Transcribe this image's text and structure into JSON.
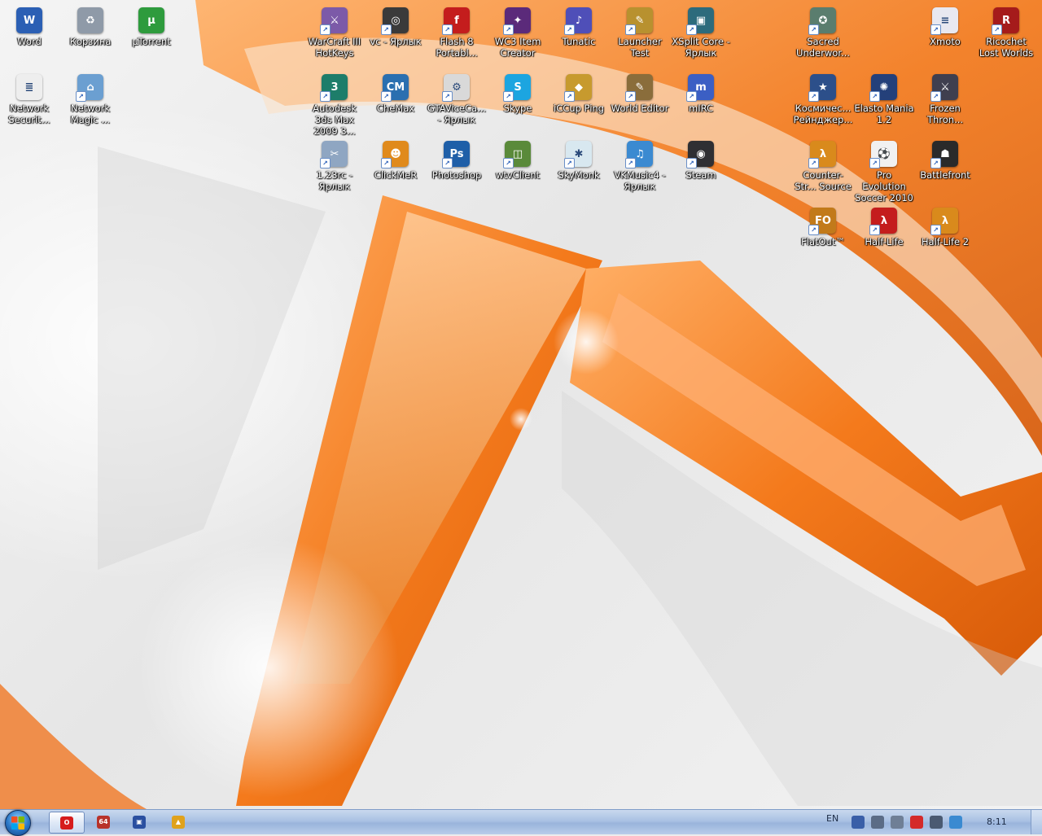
{
  "desktop_icons": [
    {
      "label": "Word",
      "icon": "word-icon",
      "color": "#2b5fb4",
      "glyph": "W",
      "shortcut": false
    },
    {
      "label": "Корзина",
      "icon": "recycle-bin-icon",
      "color": "#8f9aa8",
      "glyph": "♻",
      "shortcut": false
    },
    {
      "label": "µTorrent",
      "icon": "utorrent-icon",
      "color": "#2e9b3d",
      "glyph": "µ",
      "shortcut": false
    },
    {
      "label": "WarCraft III HotKeys",
      "icon": "warcraft-hotkeys-icon",
      "color": "#7c5aa8",
      "glyph": "⚔",
      "shortcut": true
    },
    {
      "label": "vc - Ярлык",
      "icon": "film-reel-icon",
      "color": "#3a3a3a",
      "glyph": "◎",
      "shortcut": true
    },
    {
      "label": "Flash 8 Portabl...",
      "icon": "flash-icon",
      "color": "#c41d1d",
      "glyph": "f",
      "shortcut": true
    },
    {
      "label": "WC3 Item Creator",
      "icon": "wc3-item-creator-icon",
      "color": "#5b2a7a",
      "glyph": "✦",
      "shortcut": true
    },
    {
      "label": "Tunatic",
      "icon": "tunatic-icon",
      "color": "#4f4fb8",
      "glyph": "♪",
      "shortcut": true
    },
    {
      "label": "Launcher Test",
      "icon": "launcher-icon",
      "color": "#b8912f",
      "glyph": "✎",
      "shortcut": true
    },
    {
      "label": "XSplit Core - Ярлык",
      "icon": "xsplit-icon",
      "color": "#2d6b7c",
      "glyph": "▣",
      "shortcut": true
    },
    {
      "label": "Sacred Underwor...",
      "icon": "sacred-icon",
      "color": "#5a7d6e",
      "glyph": "✪",
      "shortcut": true
    },
    {
      "label": "Xmoto",
      "icon": "xmoto-icon",
      "color": "#e8e8f0",
      "glyph": "≡",
      "shortcut": true
    },
    {
      "label": "Ricochet Lost Worlds",
      "icon": "ricochet-icon",
      "color": "#a51b1b",
      "glyph": "R",
      "shortcut": true
    },
    {
      "label": "Network Securit...",
      "icon": "document-icon",
      "color": "#eeeeee",
      "glyph": "≣",
      "shortcut": false
    },
    {
      "label": "Network Magic ...",
      "icon": "network-magic-icon",
      "color": "#6b9fd1",
      "glyph": "⌂",
      "shortcut": true
    },
    {
      "label": "Autodesk 3ds Max 2009 3...",
      "icon": "3ds-max-icon",
      "color": "#1d7d6a",
      "glyph": "3",
      "shortcut": true
    },
    {
      "label": "CheMax",
      "icon": "chemax-icon",
      "color": "#2a6fb0",
      "glyph": "CM",
      "shortcut": true
    },
    {
      "label": "GTAViceCa... - Ярлык",
      "icon": "gta-icon",
      "color": "#d9d9d9",
      "glyph": "⚙",
      "shortcut": true
    },
    {
      "label": "Skype",
      "icon": "skype-icon",
      "color": "#1ca5e0",
      "glyph": "S",
      "shortcut": true
    },
    {
      "label": "iCCup Ping",
      "icon": "iccup-icon",
      "color": "#c79a2e",
      "glyph": "◆",
      "shortcut": true
    },
    {
      "label": "World Editor",
      "icon": "world-editor-icon",
      "color": "#8a6d3b",
      "glyph": "✎",
      "shortcut": true
    },
    {
      "label": "mIRC",
      "icon": "mirc-icon",
      "color": "#3b5fc4",
      "glyph": "m",
      "shortcut": true
    },
    {
      "label": "Космичес... Рейнджер...",
      "icon": "space-rangers-icon",
      "color": "#2c4f8a",
      "glyph": "★",
      "shortcut": true
    },
    {
      "label": "Elasto Mania 1.2",
      "icon": "elasto-mania-icon",
      "color": "#24407a",
      "glyph": "✺",
      "shortcut": true
    },
    {
      "label": "Frozen Thron...",
      "icon": "frozen-throne-icon",
      "color": "#3f3f4f",
      "glyph": "⚔",
      "shortcut": true
    },
    {
      "label": "1.23rc - Ярлык",
      "icon": "wrench-icon",
      "color": "#8fa6c2",
      "glyph": "✂",
      "shortcut": true
    },
    {
      "label": "ClickMeR",
      "icon": "clickmer-icon",
      "color": "#e08a1c",
      "glyph": "☻",
      "shortcut": true
    },
    {
      "label": "Photoshop",
      "icon": "photoshop-icon",
      "color": "#1f5fa8",
      "glyph": "Ps",
      "shortcut": true
    },
    {
      "label": "wtvClient",
      "icon": "wtv-icon",
      "color": "#5a8a3a",
      "glyph": "◫",
      "shortcut": true
    },
    {
      "label": "SkyMonk",
      "icon": "skymonk-icon",
      "color": "#d8e8f0",
      "glyph": "✱",
      "shortcut": true
    },
    {
      "label": "VKMusic4 - Ярлык",
      "icon": "vkmusic-icon",
      "color": "#3b8ad1",
      "glyph": "♫",
      "shortcut": true
    },
    {
      "label": "Steam",
      "icon": "steam-icon",
      "color": "#2f2f33",
      "glyph": "◉",
      "shortcut": true
    },
    {
      "label": "Counter-Str... Source",
      "icon": "half-life-lambda-icon",
      "color": "#d98a1c",
      "glyph": "λ",
      "shortcut": true
    },
    {
      "label": "Pro Evolution Soccer 2010",
      "icon": "pes-icon",
      "color": "#f1f1f1",
      "glyph": "⚽",
      "shortcut": true
    },
    {
      "label": "Battlefront",
      "icon": "battlefront-icon",
      "color": "#2a2a2a",
      "glyph": "☗",
      "shortcut": true
    },
    {
      "label": "FlatOut™",
      "icon": "flatout-icon",
      "color": "#c27a1a",
      "glyph": "FO",
      "shortcut": true
    },
    {
      "label": "Half-Life",
      "icon": "half-life-icon",
      "color": "#c41d1d",
      "glyph": "λ",
      "shortcut": true
    },
    {
      "label": "Half-Life 2",
      "icon": "half-life-2-icon",
      "color": "#d98a1c",
      "glyph": "λ",
      "shortcut": true
    }
  ],
  "taskbar": {
    "start_icon": "windows-start-orb-icon",
    "pinned": [
      {
        "icon": "opera-icon",
        "color": "#d61c1c",
        "glyph": "O",
        "active": true
      },
      {
        "icon": "aida64-icon",
        "color": "#b8322a",
        "glyph": "64",
        "active": false
      },
      {
        "icon": "floppy-save-icon",
        "color": "#2a4fa0",
        "glyph": "▣",
        "active": false
      },
      {
        "icon": "aimp-icon",
        "color": "#e0a21c",
        "glyph": "▲",
        "active": false
      }
    ],
    "language": "EN",
    "tray_icons": [
      {
        "icon": "network-tray-icon",
        "color": "#3a5fa8"
      },
      {
        "icon": "volume-icon",
        "color": "#5b6c86"
      },
      {
        "icon": "devices-icon",
        "color": "#6f7f96"
      },
      {
        "icon": "antivirus-icon",
        "color": "#d42a2a"
      },
      {
        "icon": "action-center-flag-icon",
        "color": "#4a5a72"
      },
      {
        "icon": "monitor-tray-icon",
        "color": "#3a8ad1"
      }
    ],
    "clock": "8:11"
  }
}
